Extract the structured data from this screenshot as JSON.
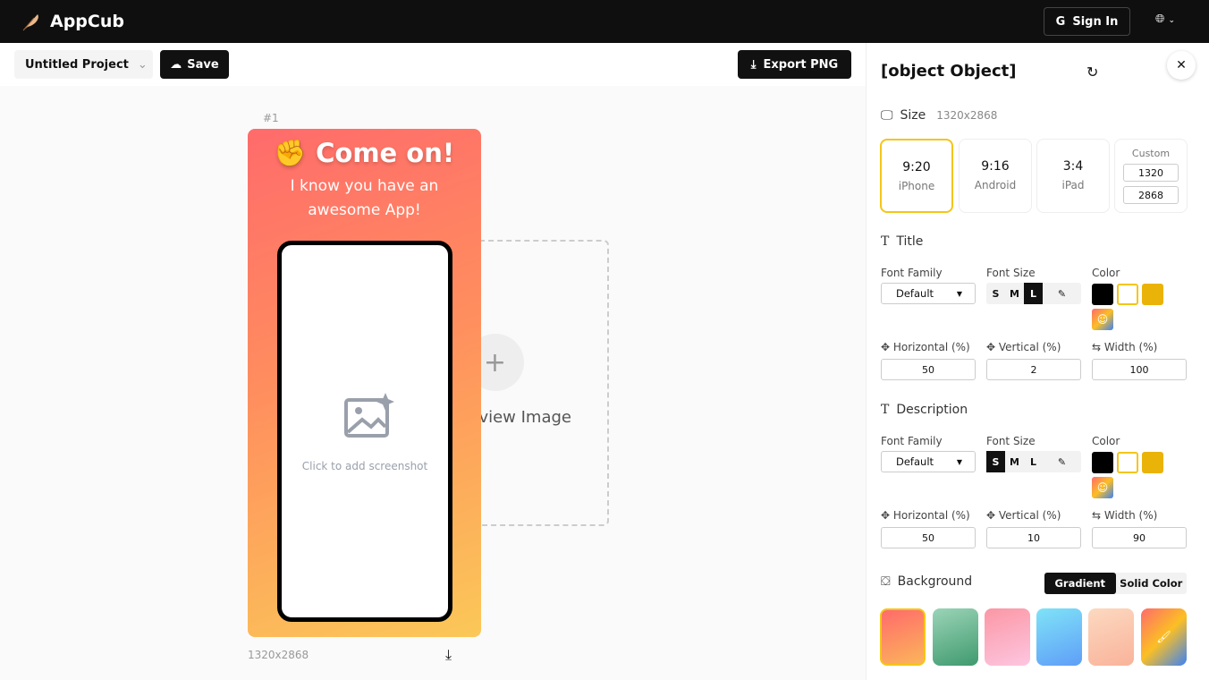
{
  "app": {
    "name": "AppCub",
    "sign_in": "Sign In"
  },
  "toolbar": {
    "project": "Untitled Project",
    "save": "Save",
    "export": "Export PNG"
  },
  "canvas": {
    "index": "#1",
    "title_emoji": "✊",
    "title": "Come on!",
    "description": "I know you have an awesome App!",
    "placeholder": "Click to add screenshot",
    "dimensions": "1320x2868",
    "preview_label": "Preview Image"
  },
  "panel": {
    "title": {
      "label": "Title",
      "font_family_label": "Font Family",
      "font_family": "Default",
      "font_size_label": "Font Size",
      "sizes": [
        "S",
        "M",
        "L"
      ],
      "selected_size": "L",
      "color_label": "Color",
      "h_label": "Horizontal (%)",
      "v_label": "Vertical (%)",
      "w_label": "Width (%)",
      "h": "50",
      "v": "2",
      "w": "100"
    },
    "size": {
      "label": "Size",
      "value": "1320x2868",
      "options": [
        {
          "ratio": "9:20",
          "name": "iPhone"
        },
        {
          "ratio": "9:16",
          "name": "Android"
        },
        {
          "ratio": "3:4",
          "name": "iPad"
        }
      ],
      "custom_label": "Custom",
      "custom_w": "1320",
      "custom_h": "2868"
    },
    "description": {
      "label": "Description",
      "font_family_label": "Font Family",
      "font_family": "Default",
      "font_size_label": "Font Size",
      "sizes": [
        "S",
        "M",
        "L"
      ],
      "selected_size": "S",
      "color_label": "Color",
      "h_label": "Horizontal (%)",
      "v_label": "Vertical (%)",
      "w_label": "Width (%)",
      "h": "50",
      "v": "10",
      "w": "90"
    },
    "background": {
      "label": "Background",
      "modes": [
        "Gradient",
        "Solid Color"
      ],
      "selected": "Gradient"
    },
    "colors": {
      "black": "#000000",
      "white": "#ffffff",
      "yellow": "#eab308",
      "accent": "#f5c518"
    }
  }
}
